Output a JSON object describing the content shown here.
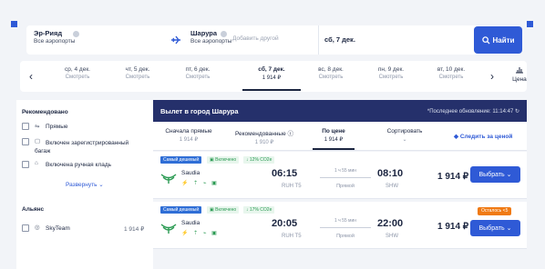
{
  "search": {
    "from_city": "Эр-Рияд",
    "from_sub": "Все аэропорты",
    "to_city": "Шарура",
    "to_sub": "Все аэропорты",
    "add_other": "Добавить другой",
    "date": "сб, 7 дек.",
    "find_label": "Найти"
  },
  "date_strip": {
    "days": [
      {
        "date": "ср, 4 дек.",
        "price": "Смотреть"
      },
      {
        "date": "чт, 5 дек.",
        "price": "Смотреть"
      },
      {
        "date": "пт, 6 дек.",
        "price": "Смотреть"
      },
      {
        "date": "сб, 7 дек.",
        "price": "1 914 ₽"
      },
      {
        "date": "вс, 8 дек.",
        "price": "Смотреть"
      },
      {
        "date": "пн, 9 дек.",
        "price": "Смотреть"
      },
      {
        "date": "вт, 10 дек.",
        "price": "Смотреть"
      }
    ],
    "price_graph_label": "Цена"
  },
  "sidebar": {
    "recommended_title": "Рекомендовано",
    "filters": [
      "Прямые",
      "Включен зарегистрированный багаж",
      "Включена ручная кладь"
    ],
    "expand_label": "Развернуть",
    "alliance_title": "Альянс",
    "alliance_name": "SkyTeam",
    "alliance_price": "1 914 ₽"
  },
  "results": {
    "title": "Вылет в город Шарура",
    "updated": "*Последнее обновление: 11:14:47",
    "sort": [
      {
        "label": "Сначала прямые",
        "price": "1 914 ₽"
      },
      {
        "label": "Рекомендованные",
        "price": "1 910 ₽"
      },
      {
        "label": "По цене",
        "price": "1 914 ₽"
      },
      {
        "label": "Сортировать",
        "price": ""
      }
    ],
    "follow_label": "Следить за ценой"
  },
  "flights": [
    {
      "tag_cheap": "Самый дешевый",
      "tag_included": "Включено",
      "tag_co2": "↓ 12% CO2e",
      "airline": "Saudia",
      "dep_time": "06:15",
      "dep_code": "RUH T5",
      "duration": "1 ч 55 мин",
      "direct": "Прямой",
      "arr_time": "08:10",
      "arr_code": "SHW",
      "price": "1 914 ₽",
      "choose": "Выбрать",
      "left_badge": ""
    },
    {
      "tag_cheap": "Самый дешевый",
      "tag_included": "Включено",
      "tag_co2": "↓ 17% CO2e",
      "airline": "Saudia",
      "dep_time": "20:05",
      "dep_code": "RUH T5",
      "duration": "1 ч 55 мин",
      "direct": "Прямой",
      "arr_time": "22:00",
      "arr_code": "SHW",
      "price": "1 914 ₽",
      "choose": "Выбрать",
      "left_badge": "Осталось <5"
    }
  ],
  "colors": {
    "accent": "#2f5ad6",
    "header": "#25306b",
    "green": "#2a9a52",
    "orange": "#f07a14"
  }
}
